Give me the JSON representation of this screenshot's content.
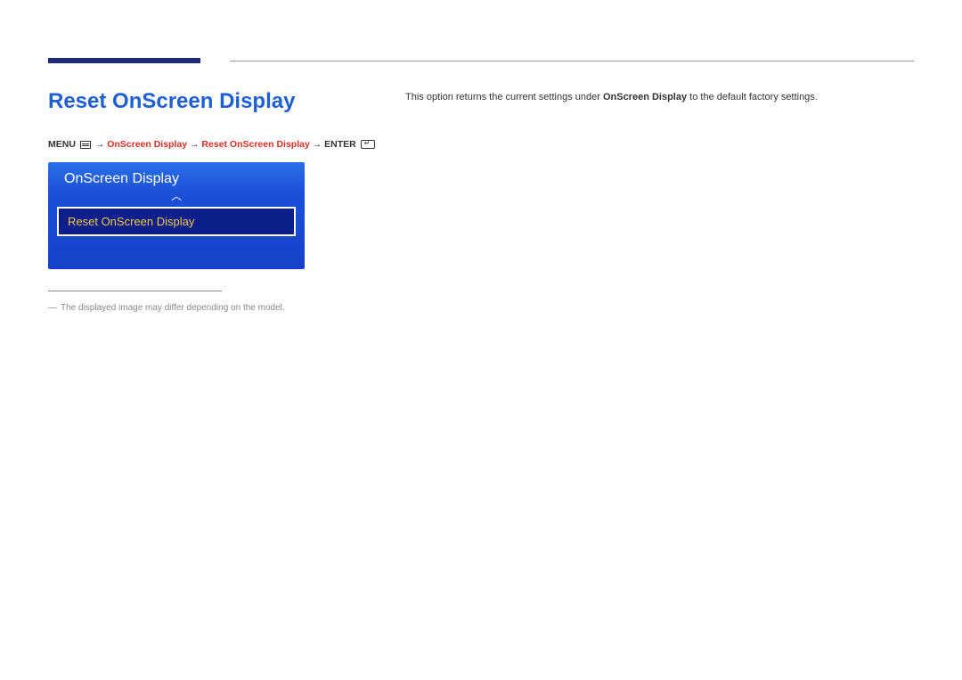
{
  "title": "Reset OnScreen Display",
  "description": {
    "prefix": "This option returns the current settings under ",
    "bold": "OnScreen Display",
    "suffix": " to the default factory settings."
  },
  "breadcrumb": {
    "menu": "MENU",
    "arrow": " → ",
    "item1": "OnScreen Display",
    "item2": "Reset OnScreen Display",
    "enter": "ENTER"
  },
  "osd": {
    "header": "OnScreen Display",
    "chevron": "︿",
    "selected": "Reset OnScreen Display"
  },
  "footnote": {
    "dash": "―",
    "text": "The displayed image may differ depending on the model."
  }
}
